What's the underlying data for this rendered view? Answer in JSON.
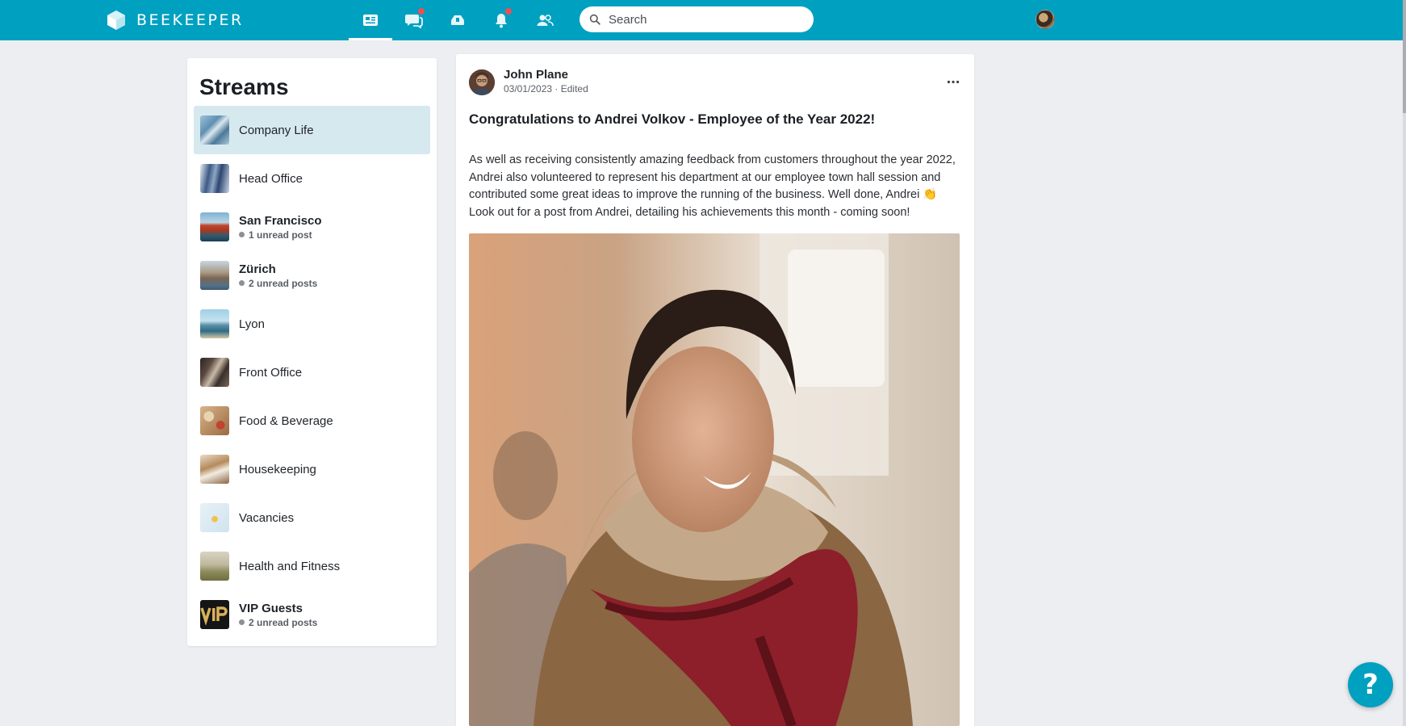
{
  "app": {
    "brand_name": "BEEKEEPER",
    "accent_color": "#00a0c0"
  },
  "nav": {
    "items": [
      {
        "icon": "news-feed-icon",
        "active": true,
        "badge": false
      },
      {
        "icon": "chat-icon",
        "active": false,
        "badge": true
      },
      {
        "icon": "tools-icon",
        "active": false,
        "badge": false
      },
      {
        "icon": "bell-icon",
        "active": false,
        "badge": true
      },
      {
        "icon": "people-icon",
        "active": false,
        "badge": false
      }
    ]
  },
  "search": {
    "placeholder": "Search"
  },
  "streams": {
    "title": "Streams",
    "items": [
      {
        "label": "Company Life",
        "selected": true,
        "sub": ""
      },
      {
        "label": "Head Office",
        "sub": ""
      },
      {
        "label": "San Francisco",
        "sub": "1 unread post"
      },
      {
        "label": "Zürich",
        "sub": "2 unread posts"
      },
      {
        "label": "Lyon",
        "sub": ""
      },
      {
        "label": "Front Office",
        "sub": ""
      },
      {
        "label": "Food & Beverage",
        "sub": ""
      },
      {
        "label": "Housekeeping",
        "sub": ""
      },
      {
        "label": "Vacancies",
        "sub": ""
      },
      {
        "label": "Health and Fitness",
        "sub": ""
      },
      {
        "label": "VIP Guests",
        "sub": "2 unread posts"
      }
    ]
  },
  "post": {
    "author": "John Plane",
    "date": "03/01/2023",
    "edited": "Edited",
    "title": "Congratulations to Andrei Volkov - Employee of the Year 2022!",
    "body": "As well as receiving consistently amazing feedback from customers throughout the year 2022, Andrei also volunteered to represent his department at our employee town hall session and contributed some great ideas to improve the running of the business. Well done, Andrei 👏 Look out for a post from Andrei, detailing his achievements this month - coming soon!"
  },
  "help": {
    "label": "?"
  }
}
